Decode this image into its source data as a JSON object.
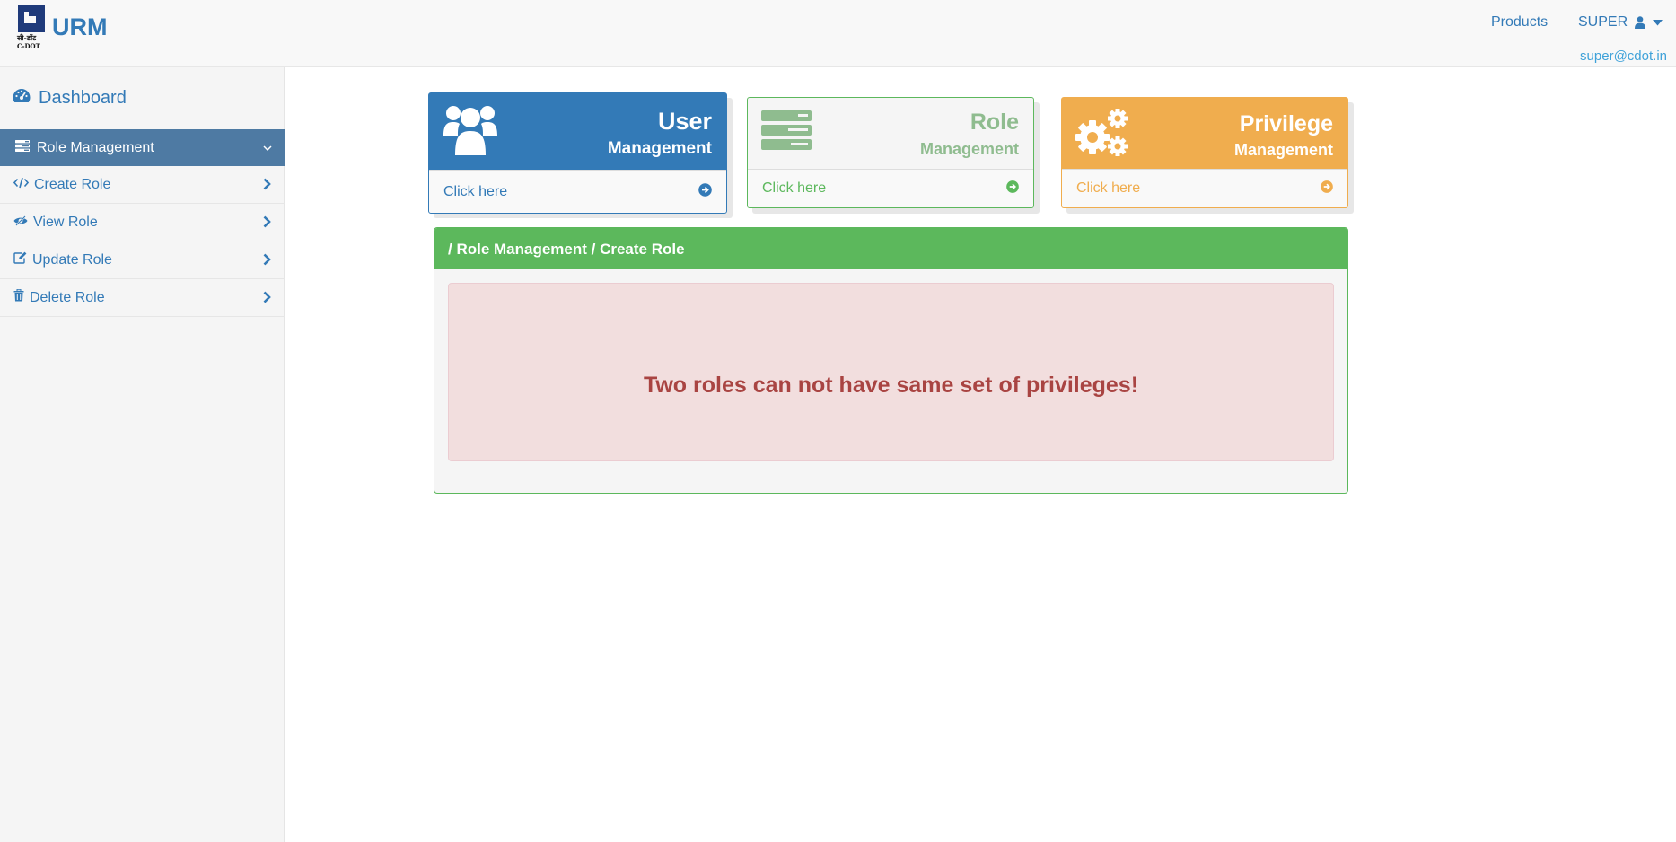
{
  "app": {
    "logo_text_hindi": "सी-डॉट",
    "logo_text_en": "C-DOT",
    "name": "URM"
  },
  "nav": {
    "products": "Products",
    "user": "SUPER",
    "email": "super@cdot.in"
  },
  "sidebar": {
    "dashboard": "Dashboard",
    "section": "Role Management",
    "items": [
      {
        "label": "Create Role",
        "icon": "code-icon"
      },
      {
        "label": "View Role",
        "icon": "eye-slash-icon"
      },
      {
        "label": "Update Role",
        "icon": "edit-icon"
      },
      {
        "label": "Delete Role",
        "icon": "trash-icon"
      }
    ]
  },
  "cards": {
    "user": {
      "title": "User",
      "subtitle": "Management",
      "link": "Click here",
      "color": "#337ab7",
      "icon": "users-icon"
    },
    "role": {
      "title": "Role",
      "subtitle": "Management",
      "link": "Click here",
      "color": "#5cb85c",
      "icon": "server-icon"
    },
    "privilege": {
      "title": "Privilege",
      "subtitle": "Management",
      "link": "Click here",
      "color": "#f0ad4e",
      "icon": "gears-icon"
    }
  },
  "panel": {
    "breadcrumb": "/ Role Management / Create Role",
    "alert": "Two roles can not have same set of privileges!"
  }
}
